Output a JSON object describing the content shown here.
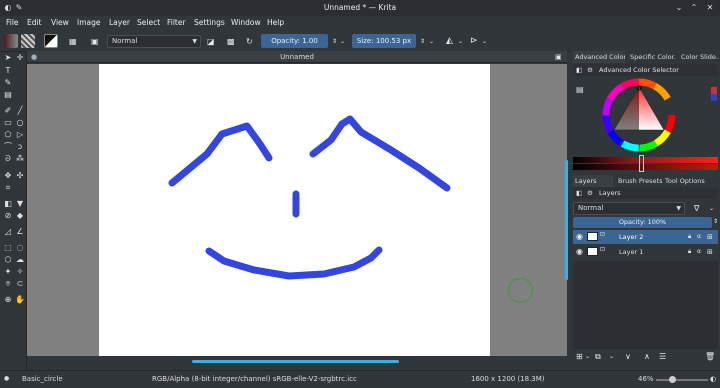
{
  "window": {
    "title": "Unnamed * — Krita"
  },
  "menu": [
    "File",
    "Edit",
    "View",
    "Image",
    "Layer",
    "Select",
    "Filter",
    "Settings",
    "Window",
    "Help"
  ],
  "toolbar": {
    "blend_mode": "Normal",
    "opacity_label": "Opacity:",
    "opacity_value": "1.00",
    "size_label": "Size:",
    "size_value": "100.53 px"
  },
  "document": {
    "tab_title": "Unnamed"
  },
  "dock_tabs_top": [
    "Advanced Color...",
    "Specific Color...",
    "Color Slide..."
  ],
  "color_selector": {
    "title": "Advanced Color Selector"
  },
  "dock_tabs_bottom": [
    "Layers",
    "Brush Presets",
    "Tool Options"
  ],
  "layers_panel": {
    "title": "Layers",
    "blend_mode": "Normal",
    "opacity": "Opacity: 100%",
    "layers": [
      {
        "name": "Layer 2",
        "selected": true
      },
      {
        "name": "Layer 1",
        "selected": false
      }
    ]
  },
  "status": {
    "brush": "Basic_circle",
    "color_model": "RGB/Alpha (8-bit integer/channel)  sRGB-elle-V2-srgbtrc.icc",
    "image_size": "1600 x 1200 (18.3M)",
    "zoom": "46%"
  },
  "colors": {
    "accent": "#3daee9",
    "stroke": "#3446e0",
    "selection": "#3b6592"
  }
}
